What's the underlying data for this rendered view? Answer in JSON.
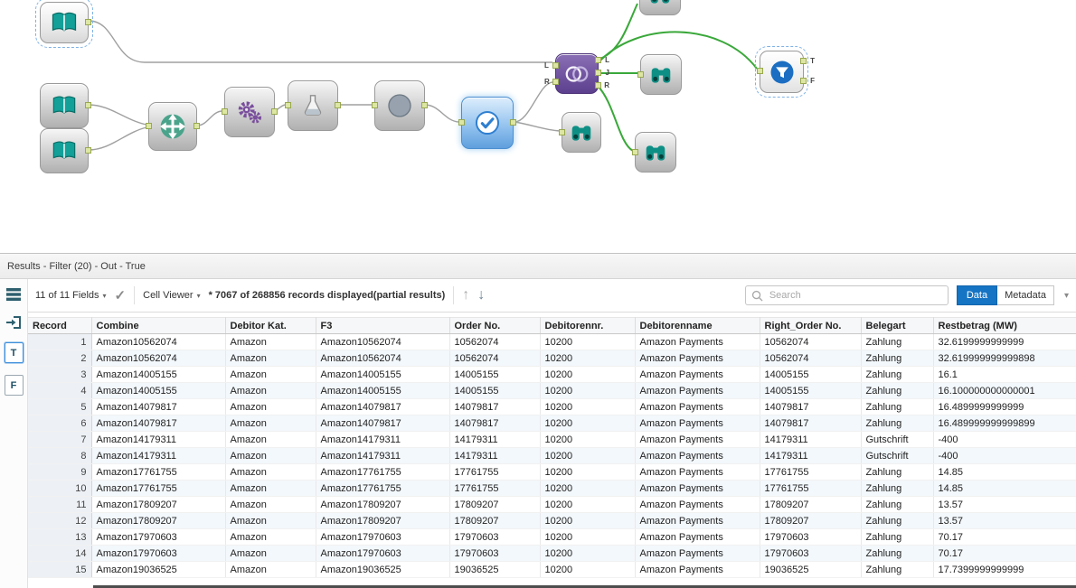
{
  "canvas": {
    "join_tool": {
      "inputs": [
        "L",
        "R"
      ],
      "outputs": [
        "L",
        "J",
        "R"
      ]
    },
    "filter_tool": {
      "outputs": [
        "T",
        "F"
      ]
    }
  },
  "results": {
    "title": "Results - Filter (20) - Out - True",
    "toolbar": {
      "fields_dropdown": "11 of 11 Fields",
      "cell_viewer_dropdown": "Cell Viewer",
      "status": "* 7067 of 268856 records displayed(partial results)",
      "search": {
        "placeholder": "Search"
      },
      "data_tab": "Data",
      "metadata_tab": "Metadata"
    },
    "anchor_tabs": {
      "true_label": "T",
      "false_label": "F"
    },
    "table": {
      "columns": [
        "Record",
        "Combine",
        "Debitor Kat.",
        "F3",
        "Order No.",
        "Debitorennr.",
        "Debitorenname",
        "Right_Order No.",
        "Belegart",
        "Restbetrag (MW)"
      ],
      "rows": [
        [
          "1",
          "Amazon10562074",
          "Amazon",
          "Amazon10562074",
          "10562074",
          "10200",
          "Amazon Payments",
          "10562074",
          "Zahlung",
          "32.6199999999999"
        ],
        [
          "2",
          "Amazon10562074",
          "Amazon",
          "Amazon10562074",
          "10562074",
          "10200",
          "Amazon Payments",
          "10562074",
          "Zahlung",
          "32.619999999999898"
        ],
        [
          "3",
          "Amazon14005155",
          "Amazon",
          "Amazon14005155",
          "14005155",
          "10200",
          "Amazon Payments",
          "14005155",
          "Zahlung",
          "16.1"
        ],
        [
          "4",
          "Amazon14005155",
          "Amazon",
          "Amazon14005155",
          "14005155",
          "10200",
          "Amazon Payments",
          "14005155",
          "Zahlung",
          "16.100000000000001"
        ],
        [
          "5",
          "Amazon14079817",
          "Amazon",
          "Amazon14079817",
          "14079817",
          "10200",
          "Amazon Payments",
          "14079817",
          "Zahlung",
          "16.4899999999999"
        ],
        [
          "6",
          "Amazon14079817",
          "Amazon",
          "Amazon14079817",
          "14079817",
          "10200",
          "Amazon Payments",
          "14079817",
          "Zahlung",
          "16.489999999999899"
        ],
        [
          "7",
          "Amazon14179311",
          "Amazon",
          "Amazon14179311",
          "14179311",
          "10200",
          "Amazon Payments",
          "14179311",
          "Gutschrift",
          "-400"
        ],
        [
          "8",
          "Amazon14179311",
          "Amazon",
          "Amazon14179311",
          "14179311",
          "10200",
          "Amazon Payments",
          "14179311",
          "Gutschrift",
          "-400"
        ],
        [
          "9",
          "Amazon17761755",
          "Amazon",
          "Amazon17761755",
          "17761755",
          "10200",
          "Amazon Payments",
          "17761755",
          "Zahlung",
          "14.85"
        ],
        [
          "10",
          "Amazon17761755",
          "Amazon",
          "Amazon17761755",
          "17761755",
          "10200",
          "Amazon Payments",
          "17761755",
          "Zahlung",
          "14.85"
        ],
        [
          "11",
          "Amazon17809207",
          "Amazon",
          "Amazon17809207",
          "17809207",
          "10200",
          "Amazon Payments",
          "17809207",
          "Zahlung",
          "13.57"
        ],
        [
          "12",
          "Amazon17809207",
          "Amazon",
          "Amazon17809207",
          "17809207",
          "10200",
          "Amazon Payments",
          "17809207",
          "Zahlung",
          "13.57"
        ],
        [
          "13",
          "Amazon17970603",
          "Amazon",
          "Amazon17970603",
          "17970603",
          "10200",
          "Amazon Payments",
          "17970603",
          "Zahlung",
          "70.17"
        ],
        [
          "14",
          "Amazon17970603",
          "Amazon",
          "Amazon17970603",
          "17970603",
          "10200",
          "Amazon Payments",
          "17970603",
          "Zahlung",
          "70.17"
        ],
        [
          "15",
          "Amazon19036525",
          "Amazon",
          "Amazon19036525",
          "19036525",
          "10200",
          "Amazon Payments",
          "19036525",
          "Zahlung",
          "17.7399999999999"
        ]
      ]
    }
  }
}
